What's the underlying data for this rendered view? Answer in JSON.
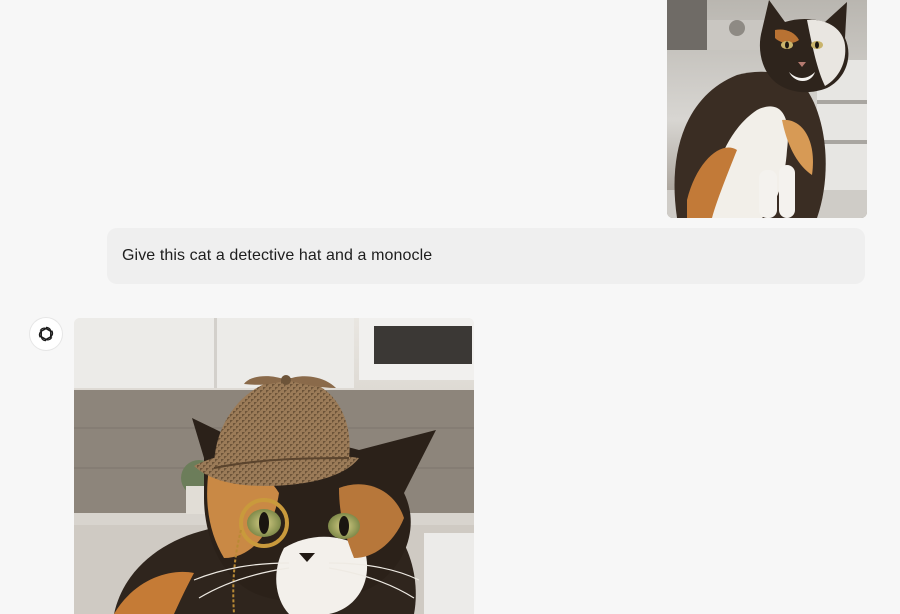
{
  "conversation": {
    "user_message": {
      "image_alt": "Calico cat sitting indoors",
      "text": "Give this cat a detective hat and a monocle"
    },
    "assistant_message": {
      "avatar_icon": "openai-logo-icon",
      "image_alt": "Calico cat wearing a detective deerstalker hat and a monocle"
    }
  },
  "colors": {
    "background": "#f7f7f7",
    "bubble": "#efefef",
    "text": "#1e1e1e"
  }
}
